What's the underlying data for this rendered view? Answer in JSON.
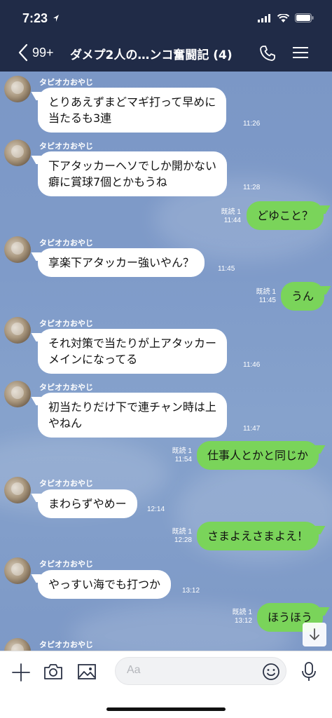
{
  "status_bar": {
    "time": "7:23"
  },
  "header": {
    "back_count": "99+",
    "title": "ダメプ2人の…ンコ奮闘記 (4)"
  },
  "messages": [
    {
      "sender": "タピオカおやじ",
      "lines": [
        "とりあえずまどマギ打って早めに",
        "当たるも3連"
      ],
      "time": "11:26"
    },
    {
      "sender": "タピオカおやじ",
      "lines": [
        "下アタッカーヘソでしか開かない",
        "癖に賞球7個とかもうね"
      ],
      "time": "11:28"
    },
    {
      "read": "既読 1",
      "text": "どゆこと？",
      "time": "11:44"
    },
    {
      "sender": "タピオカおやじ",
      "text": "享楽下アタッカー強いやん？",
      "time": "11:45"
    },
    {
      "read": "既読 1",
      "text": "うん",
      "time": "11:45"
    },
    {
      "sender": "タピオカおやじ",
      "lines": [
        "それ対策で当たりが上アタッカー",
        "メインになってる"
      ],
      "time": "11:46"
    },
    {
      "sender": "タピオカおやじ",
      "lines": [
        "初当たりだけ下で連チャン時は上",
        "やねん"
      ],
      "time": "11:47"
    },
    {
      "read": "既読 1",
      "text": "仕事人とかと同じか",
      "time": "11:54"
    },
    {
      "sender": "タピオカおやじ",
      "text": "まわらずやめー",
      "time": "12:14"
    },
    {
      "read": "既読 1",
      "text": "さまよえさまよえ！",
      "time": "12:28"
    },
    {
      "sender": "タピオカおやじ",
      "text": "やっすい海でも打つか",
      "time": "13:12"
    },
    {
      "read": "既読 1",
      "text": "ほうほう",
      "time": "13:12"
    },
    {
      "sender": "タピオカおやじ"
    }
  ],
  "input": {
    "placeholder": "Aa"
  },
  "icons": {
    "back": "chevron-left-icon",
    "phone": "phone-icon",
    "menu": "menu-icon",
    "add": "plus-icon",
    "camera": "camera-icon",
    "image": "image-icon",
    "emoji": "emoji-icon",
    "mic": "microphone-icon",
    "scroll": "arrow-down-icon"
  },
  "colors": {
    "header": "#202b47",
    "outgoing_bubble": "#7ad45a",
    "incoming_bubble": "#ffffff",
    "chat_bg": "#7f9bc9"
  }
}
